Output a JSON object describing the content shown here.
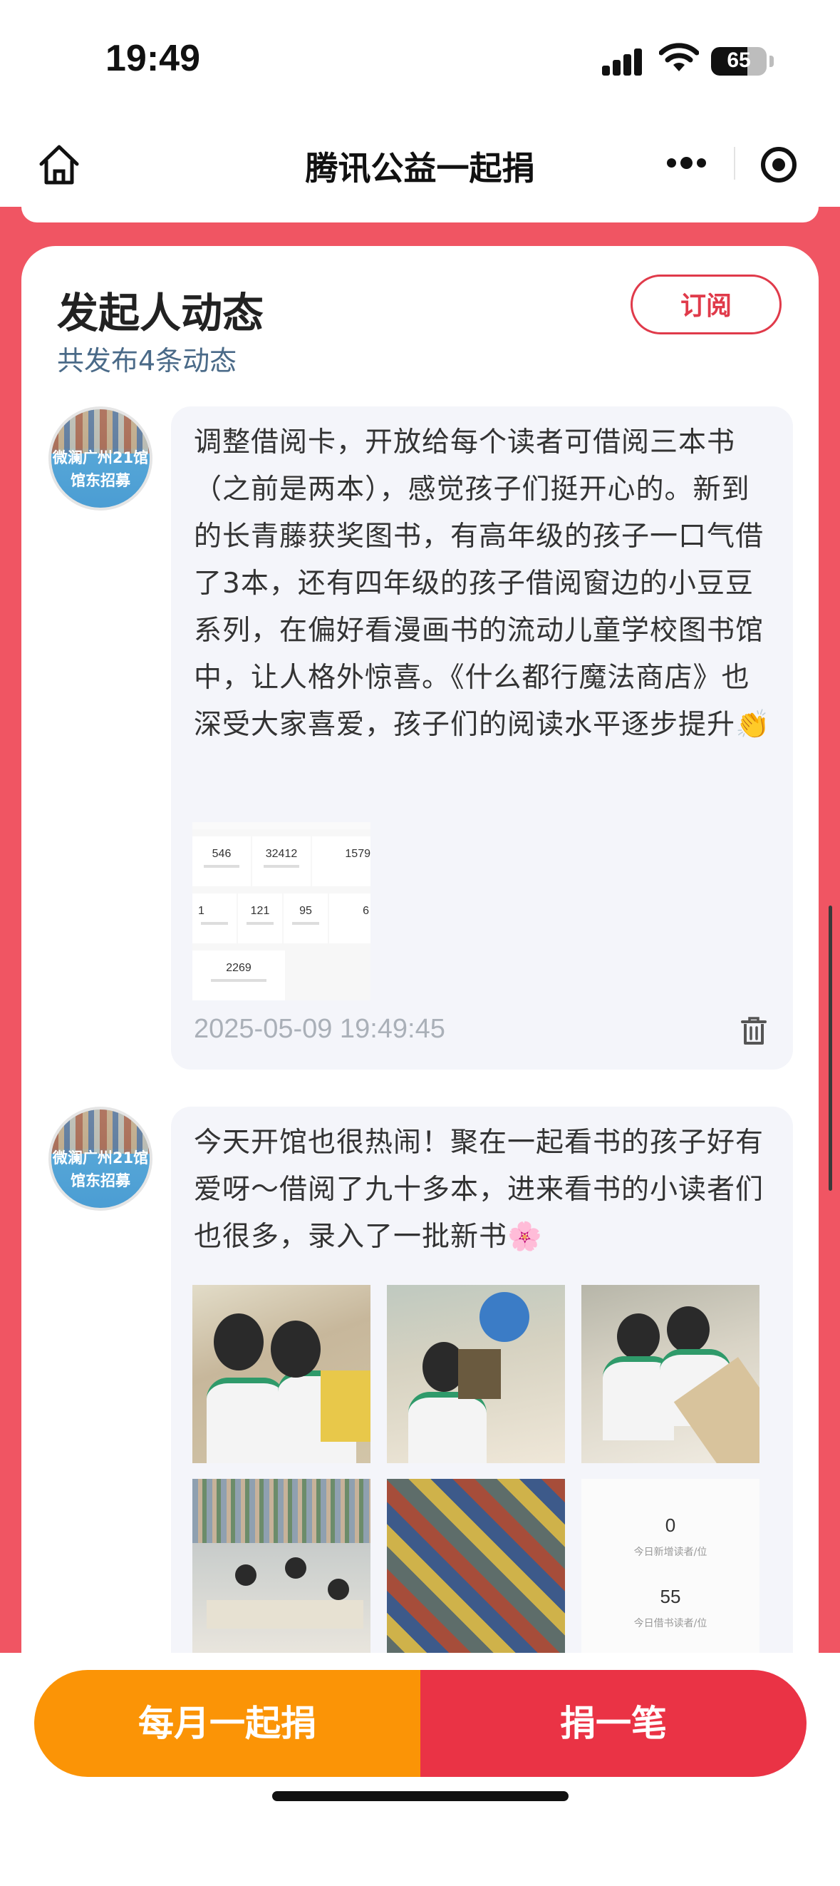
{
  "status_bar": {
    "time": "19:49",
    "battery": "65",
    "battery_level": 0.65
  },
  "nav": {
    "title": "腾讯公益一起捐",
    "home_icon": "home-icon",
    "more_icon": "more-dots-icon",
    "close_icon": "target-icon"
  },
  "section": {
    "title": "发起人动态",
    "subtitle": "共发布4条动态",
    "subscribe_label": "订阅"
  },
  "posts": [
    {
      "avatar_text": "微澜广州21馆\n馆东招募",
      "text": "调整借阅卡，开放给每个读者可借阅三本书（之前是两本），感觉孩子们挺开心的。新到的长青藤获奖图书，有高年级的孩子一口气借了3本，还有四年级的孩子借阅窗边的小豆豆系列，在偏好看漫画书的流动儿童学校图书馆中，让人格外惊喜。《什么都行魔法商店》也深受大家喜爱，孩子们的阅读水平逐步提升👏",
      "stats_image": [
        "546",
        "32412",
        "1579",
        "1",
        "121",
        "95",
        "6",
        "2269"
      ],
      "time": "2025-05-09 19:49:45"
    },
    {
      "avatar_text": "微澜广州21馆\n馆东招募",
      "text": "今天开馆也很热闹！聚在一起看书的孩子好有爱呀～借阅了九十多本，进来看书的小读者们也很多，录入了一批新书🌸",
      "stats_image": [
        "0",
        "今日新增读者/位",
        "55",
        "今日借书读者/位"
      ]
    }
  ],
  "bottom": {
    "monthly_label": "每月一起捐",
    "once_label": "捐一笔"
  }
}
